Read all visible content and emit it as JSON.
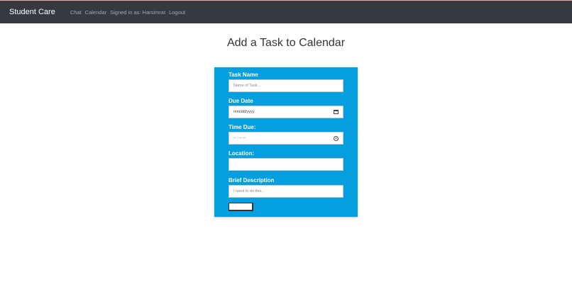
{
  "navbar": {
    "brand": "Student Care",
    "links": [
      "Chat",
      "Calendar",
      "Signed in as: Harsimrat",
      "Logout"
    ]
  },
  "page": {
    "title": "Add a Task to Calendar"
  },
  "form": {
    "task_name": {
      "label": "Task Name",
      "placeholder": "Name of Task..."
    },
    "due_date": {
      "label": "Due Date",
      "placeholder": "mm/dd/yyyy",
      "icon": "calendar-icon"
    },
    "time_due": {
      "label": "Time Due:",
      "placeholder": "-- : -- --",
      "icon": "clock-icon"
    },
    "location": {
      "label": "Location:",
      "placeholder": ""
    },
    "description": {
      "label": "Brief Description",
      "placeholder": "I need to do this..."
    },
    "submit_label": ""
  },
  "colors": {
    "navbar_bg": "#343a40",
    "form_bg": "#049fdf"
  }
}
